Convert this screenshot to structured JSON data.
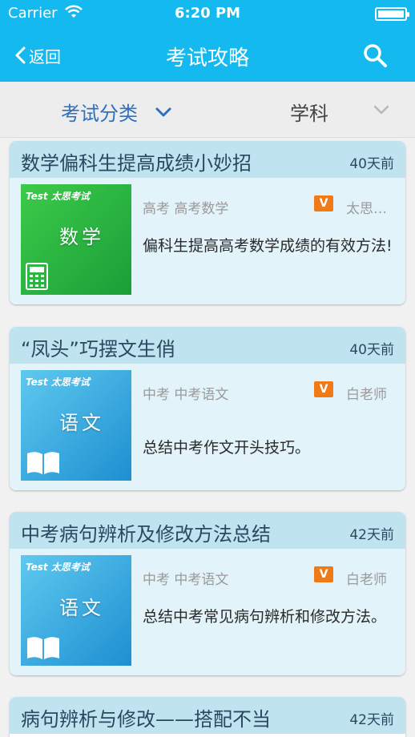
{
  "status": {
    "carrier": "Carrier",
    "time": "6:20 PM"
  },
  "nav": {
    "back_label": "返回",
    "title": "考试攻略"
  },
  "filters": {
    "category_label": "考试分类",
    "subject_label": "学科"
  },
  "articles": [
    {
      "title": "数学偏科生提高成绩小妙招",
      "ago": "40天前",
      "meta": "高考  高考数学",
      "badge": "V",
      "author": "太思…",
      "desc": "偏科生提高高考数学成绩的有效方法!",
      "thumb_brand": "Test 太思考试",
      "thumb_subject": "数学"
    },
    {
      "title": "“凤头”巧摆文生俏",
      "ago": "40天前",
      "meta": "中考  中考语文",
      "badge": "V",
      "author": "白老师",
      "desc": "总结中考作文开头技巧。",
      "thumb_brand": "Test 太思考试",
      "thumb_subject": "语文"
    },
    {
      "title": "中考病句辨析及修改方法总结",
      "ago": "42天前",
      "meta": "中考  中考语文",
      "badge": "V",
      "author": "白老师",
      "desc": "总结中考常见病句辨析和修改方法。",
      "thumb_brand": "Test 太思考试",
      "thumb_subject": "语文"
    },
    {
      "title": "病句辨析与修改——搭配不当",
      "ago": "42天前"
    }
  ],
  "colors": {
    "header": "#13b9ef",
    "accent_blue": "#2d6fc0",
    "badge_orange": "#f07a16",
    "card_head": "#bfe3ef",
    "card_body": "#e2f3fa"
  },
  "icons": {
    "back": "chevron-left-icon",
    "search": "search-icon",
    "filter_category": "chevron-down-icon",
    "filter_subject": "chevron-down-icon",
    "math": "calculator-icon",
    "chinese": "open-book-icon"
  }
}
